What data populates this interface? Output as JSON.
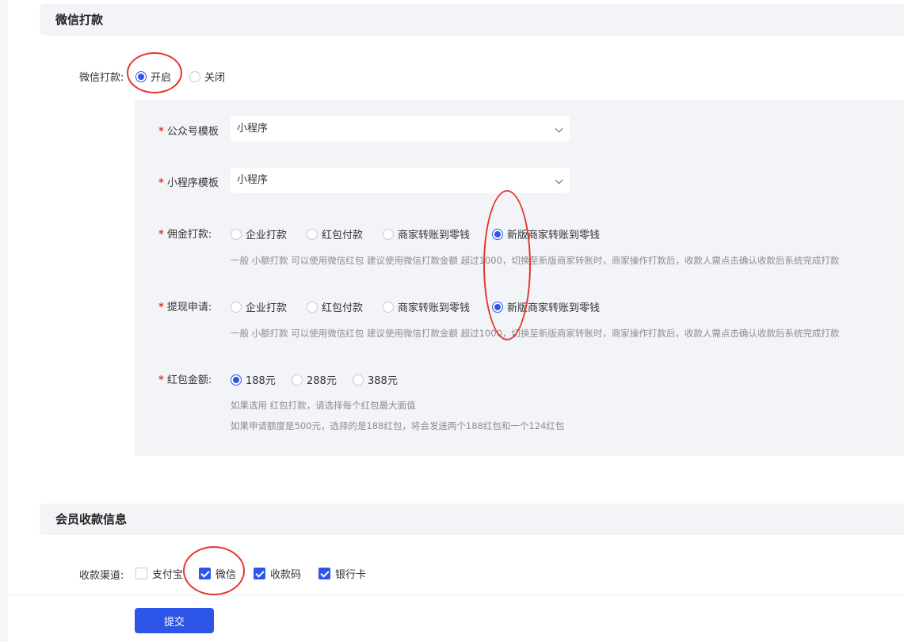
{
  "wechat_section": {
    "title": "微信打款",
    "toggle_label": "微信打款:",
    "toggle_options": [
      {
        "label": "开启",
        "selected": true
      },
      {
        "label": "关闭",
        "selected": false
      }
    ],
    "official_template": {
      "label": "公众号模板",
      "value": "小程序"
    },
    "mini_template": {
      "label": "小程序模板",
      "value": "小程序"
    },
    "commission": {
      "label": "佣金打款:",
      "options": [
        {
          "label": "企业打款",
          "selected": false
        },
        {
          "label": "红包付款",
          "selected": false
        },
        {
          "label": "商家转账到零钱",
          "selected": false
        },
        {
          "label": "新版商家转账到零钱",
          "selected": true
        }
      ],
      "hint": "一般 小额打款 可以使用微信红包 建议使用微信打款金额 超过1000，切换至新版商家转账时，商家操作打款后，收款人需点击确认收款后系统完成打款"
    },
    "withdraw": {
      "label": "提现申请:",
      "options": [
        {
          "label": "企业打款",
          "selected": false
        },
        {
          "label": "红包付款",
          "selected": false
        },
        {
          "label": "商家转账到零钱",
          "selected": false
        },
        {
          "label": "新版商家转账到零钱",
          "selected": true
        }
      ],
      "hint": "一般 小额打款 可以使用微信红包 建议使用微信打款金额 超过1000，切换至新版商家转账时，商家操作打款后，收款人需点击确认收款后系统完成打款"
    },
    "redpacket": {
      "label": "红包金额:",
      "options": [
        {
          "label": "188元",
          "selected": true
        },
        {
          "label": "288元",
          "selected": false
        },
        {
          "label": "388元",
          "selected": false
        }
      ],
      "hint1": "如果选用 红包打款，请选择每个红包最大面值",
      "hint2": "如果申请额度是500元，选择的是188红包，将会发送两个188红包和一个124红包"
    }
  },
  "member_section": {
    "title": "会员收款信息",
    "channel_label": "收款渠道:",
    "channels": [
      {
        "label": "支付宝",
        "checked": false
      },
      {
        "label": "微信",
        "checked": true
      },
      {
        "label": "收款码",
        "checked": true
      },
      {
        "label": "银行卡",
        "checked": true
      }
    ]
  },
  "submit_label": "提交",
  "colors": {
    "accent": "#2d55e8",
    "annotation": "#e4362e",
    "required": "#e5352b"
  }
}
